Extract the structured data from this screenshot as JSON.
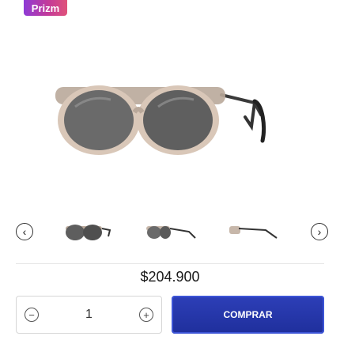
{
  "badge": {
    "label": "Prizm"
  },
  "product": {
    "image_icon": "round-sunglasses",
    "price": "$204.900"
  },
  "carousel": {
    "prev_icon": "arrow-left-circle-icon",
    "next_icon": "arrow-right-circle-icon",
    "thumbnails": [
      {
        "view": "front"
      },
      {
        "view": "three-quarter"
      },
      {
        "view": "side"
      }
    ]
  },
  "purchase": {
    "quantity": "1",
    "minus_icon": "minus-circle-icon",
    "plus_icon": "plus-circle-icon",
    "buy_label": "COMPRAR"
  },
  "colors": {
    "badge_start": "#8e3bd6",
    "badge_end": "#e0527a",
    "buy_button": "#2d3fb8"
  }
}
